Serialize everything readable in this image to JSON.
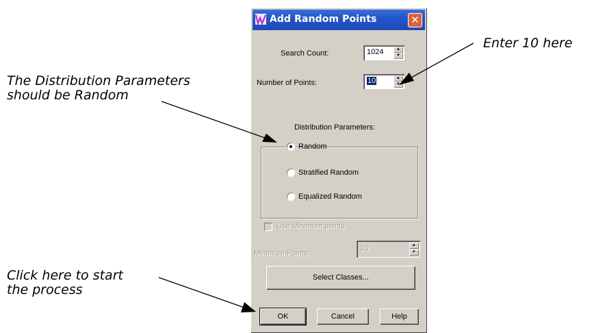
{
  "annotations": {
    "distribution": [
      "The Distribution Parameters",
      "should be Random"
    ],
    "enter": "Enter 10 here",
    "ok": [
      "Click here to start",
      "the process"
    ]
  },
  "dialog": {
    "title": "Add Random Points",
    "close_label": "✕",
    "search_count": {
      "label": "Search Count:",
      "value": "1024"
    },
    "number_of_points": {
      "label": "Number of Points:",
      "value": "10"
    },
    "distribution_title": "Distribution Parameters:",
    "distribution_options": [
      {
        "label": "Random",
        "checked": true
      },
      {
        "label": "Stratified Random",
        "checked": false
      },
      {
        "label": "Equalized Random",
        "checked": false
      }
    ],
    "use_minimum_points": {
      "label": "Use Minimum points",
      "checked": false
    },
    "minimum_points": {
      "label": "Minimum Points:",
      "value": "10"
    },
    "select_classes_label": "Select Classes...",
    "buttons": {
      "ok": "OK",
      "cancel": "Cancel",
      "help": "Help"
    }
  },
  "colors": {
    "title_bar": "#2356c9",
    "dialog_bg": "#d4d0c8",
    "close_button": "#e06040"
  }
}
